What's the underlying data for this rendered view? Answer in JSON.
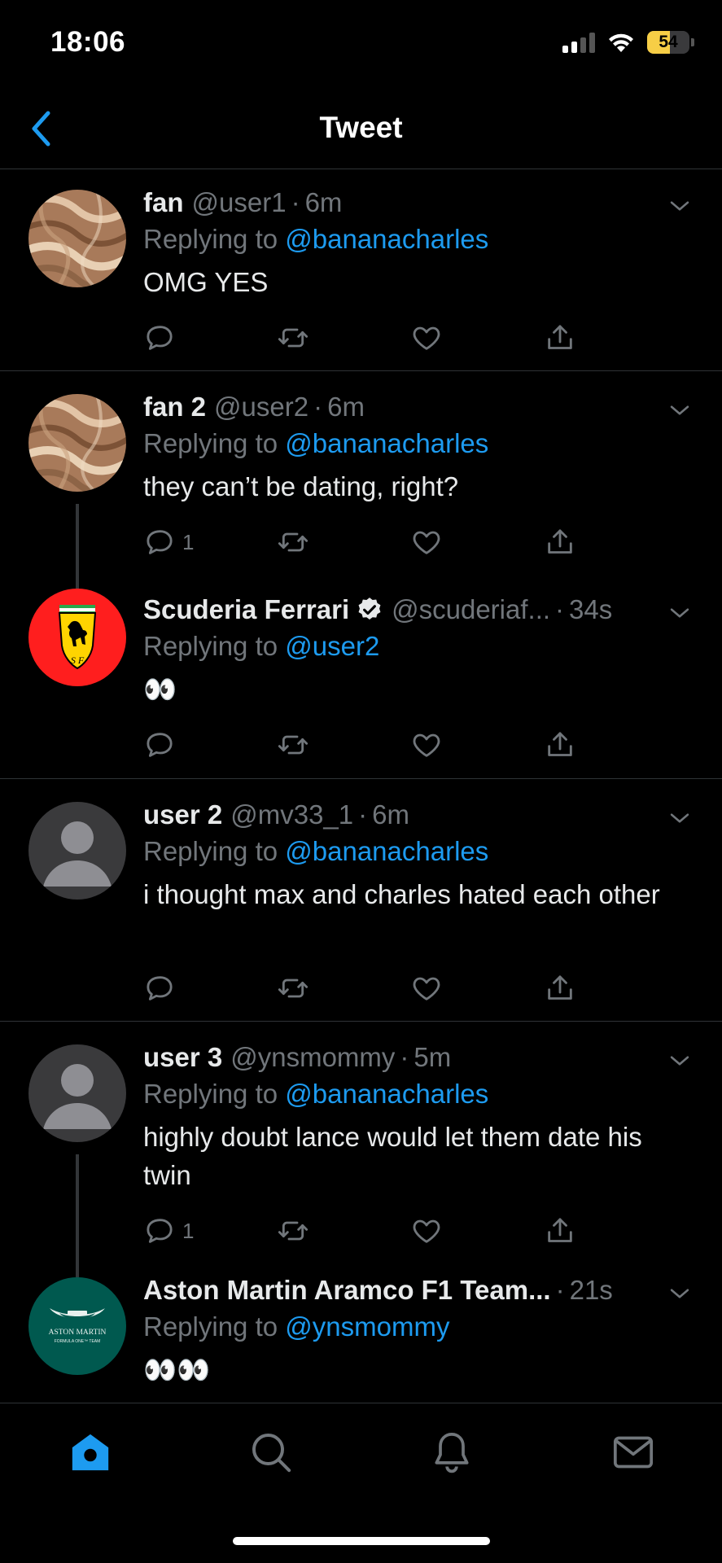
{
  "status_bar": {
    "time": "18:06",
    "battery": "54",
    "battery_level": 0.54
  },
  "nav": {
    "title": "Tweet"
  },
  "tweets": [
    {
      "name": "fan",
      "handle": "@user1",
      "time": "6m",
      "replying_prefix": "Replying to ",
      "replying_to": "@bananacharles",
      "text": "OMG YES",
      "reply_count": ""
    },
    {
      "name": "fan 2",
      "handle": "@user2",
      "time": "6m",
      "replying_prefix": "Replying to ",
      "replying_to": "@bananacharles",
      "text": "they can’t be dating, right?",
      "reply_count": "1"
    },
    {
      "name": "Scuderia Ferrari",
      "handle": "@scuderiaf...",
      "time": "34s",
      "replying_prefix": "Replying to ",
      "replying_to": "@user2",
      "text": "👀",
      "reply_count": ""
    },
    {
      "name": "user 2",
      "handle": "@mv33_1",
      "time": "6m",
      "replying_prefix": "Replying to ",
      "replying_to": "@bananacharles",
      "text": "i thought max and charles hated each other",
      "reply_count": ""
    },
    {
      "name": "user 3",
      "handle": "@ynsmommy",
      "time": "5m",
      "replying_prefix": "Replying to ",
      "replying_to": "@bananacharles",
      "text": "highly doubt lance would let them date his twin",
      "reply_count": "1"
    },
    {
      "name": "Aston Martin Aramco F1 Team...",
      "handle": "",
      "time": "21s",
      "replying_prefix": "Replying to ",
      "replying_to": "@ynsmommy",
      "text": "👀👀",
      "reply_count": ""
    }
  ],
  "aston_logo": {
    "line1": "ASTON MARTIN",
    "line2": "FORMULA ONE™ TEAM"
  },
  "ferrari_logo": {
    "initials": "S F"
  },
  "dot": "·",
  "colors": {
    "accent": "#1d9bf0",
    "background": "#000000",
    "muted": "#71767b",
    "ferrari_red": "#ff1e1e",
    "aston_green": "#00594f"
  },
  "tabs": [
    "home-icon",
    "search-icon",
    "notifications-icon",
    "messages-icon"
  ]
}
